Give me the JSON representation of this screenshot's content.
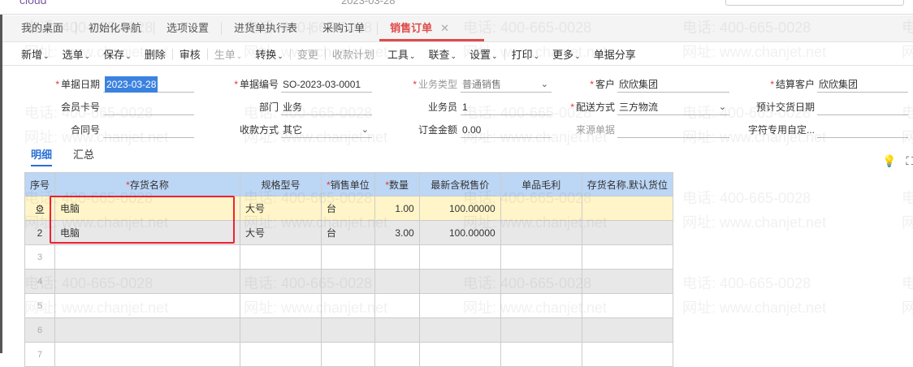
{
  "topbar": {
    "brand": "cloud",
    "date": "2023-03-28"
  },
  "tabs": [
    {
      "label": "我的桌面"
    },
    {
      "label": "初始化导航"
    },
    {
      "label": "选项设置"
    },
    {
      "label": "进货单执行表"
    },
    {
      "label": "采购订单"
    },
    {
      "label": "销售订单",
      "active": true
    }
  ],
  "toolbar": [
    {
      "label": "新增",
      "dropdown": true
    },
    {
      "label": "选单",
      "dropdown": true
    },
    {
      "label": "保存",
      "dropdown": true
    },
    {
      "label": "删除"
    },
    {
      "sep": true
    },
    {
      "label": "审核"
    },
    {
      "sep": true
    },
    {
      "label": "生单",
      "dropdown": true,
      "disabled": true
    },
    {
      "label": "转换",
      "dropdown": true
    },
    {
      "sep": true
    },
    {
      "label": "变更",
      "disabled": true
    },
    {
      "sep": true
    },
    {
      "label": "收款计划",
      "disabled": true
    },
    {
      "label": "工具",
      "dropdown": true
    },
    {
      "label": "联查",
      "dropdown": true
    },
    {
      "label": "设置",
      "dropdown": true
    },
    {
      "sep": true
    },
    {
      "label": "打印",
      "dropdown": true
    },
    {
      "label": "更多",
      "dropdown": true
    },
    {
      "label": "单据分享"
    }
  ],
  "form": {
    "doc_date": {
      "label": "单据日期",
      "value": "2023-03-28"
    },
    "doc_no": {
      "label": "单据编号",
      "value": "SO-2023-03-0001"
    },
    "biz_type": {
      "label": "业务类型",
      "value": "普通销售"
    },
    "customer": {
      "label": "客户",
      "value": "欣欣集团"
    },
    "settle_customer": {
      "label": "结算客户",
      "value": "欣欣集团"
    },
    "member_card": {
      "label": "会员卡号",
      "value": ""
    },
    "department": {
      "label": "部门",
      "value": "业务"
    },
    "salesperson": {
      "label": "业务员",
      "value": "1"
    },
    "delivery": {
      "label": "配送方式",
      "value": "三方物流"
    },
    "expected_date": {
      "label": "预计交货日期",
      "value": ""
    },
    "contract_no": {
      "label": "合同号",
      "value": ""
    },
    "payment": {
      "label": "收款方式",
      "value": "其它"
    },
    "deposit": {
      "label": "订金金额",
      "value": "0.00"
    },
    "source_doc": {
      "label": "来源单据",
      "value": ""
    },
    "custom_field": {
      "label": "字符专用自定...",
      "value": ""
    }
  },
  "subtabs": [
    {
      "label": "明细",
      "active": true
    },
    {
      "label": "汇总"
    }
  ],
  "icons": [
    "lightbulb-icon",
    "scan-icon"
  ],
  "table": {
    "columns": [
      {
        "label": "序号"
      },
      {
        "label": "存货名称",
        "required": true
      },
      {
        "label": "规格型号"
      },
      {
        "label": "销售单位",
        "required": true
      },
      {
        "label": "数量",
        "required": true
      },
      {
        "label": "最新含税售价"
      },
      {
        "label": "单品毛利"
      },
      {
        "label": "存货名称.默认货位"
      }
    ],
    "rows": [
      {
        "idx": "",
        "name": "电脑",
        "spec": "大号",
        "unit": "台",
        "qty": "1.00",
        "price": "100.00000",
        "margin": "",
        "location": ""
      },
      {
        "idx": "2",
        "name": "电脑",
        "spec": "大号",
        "unit": "台",
        "qty": "3.00",
        "price": "100.00000",
        "margin": "",
        "location": ""
      },
      {
        "idx": "3"
      },
      {
        "idx": "4"
      },
      {
        "idx": "5"
      },
      {
        "idx": "6"
      },
      {
        "idx": "7"
      }
    ]
  },
  "watermark": {
    "phone": "电话: 400-665-0028",
    "site": "网址: www.chanjet.net"
  },
  "colors": {
    "accent": "#e04a4a",
    "header": "#bcd6f5",
    "selected_row": "#fff5c8",
    "highlight_box": "#e22233",
    "link": "#2a6fd6"
  }
}
